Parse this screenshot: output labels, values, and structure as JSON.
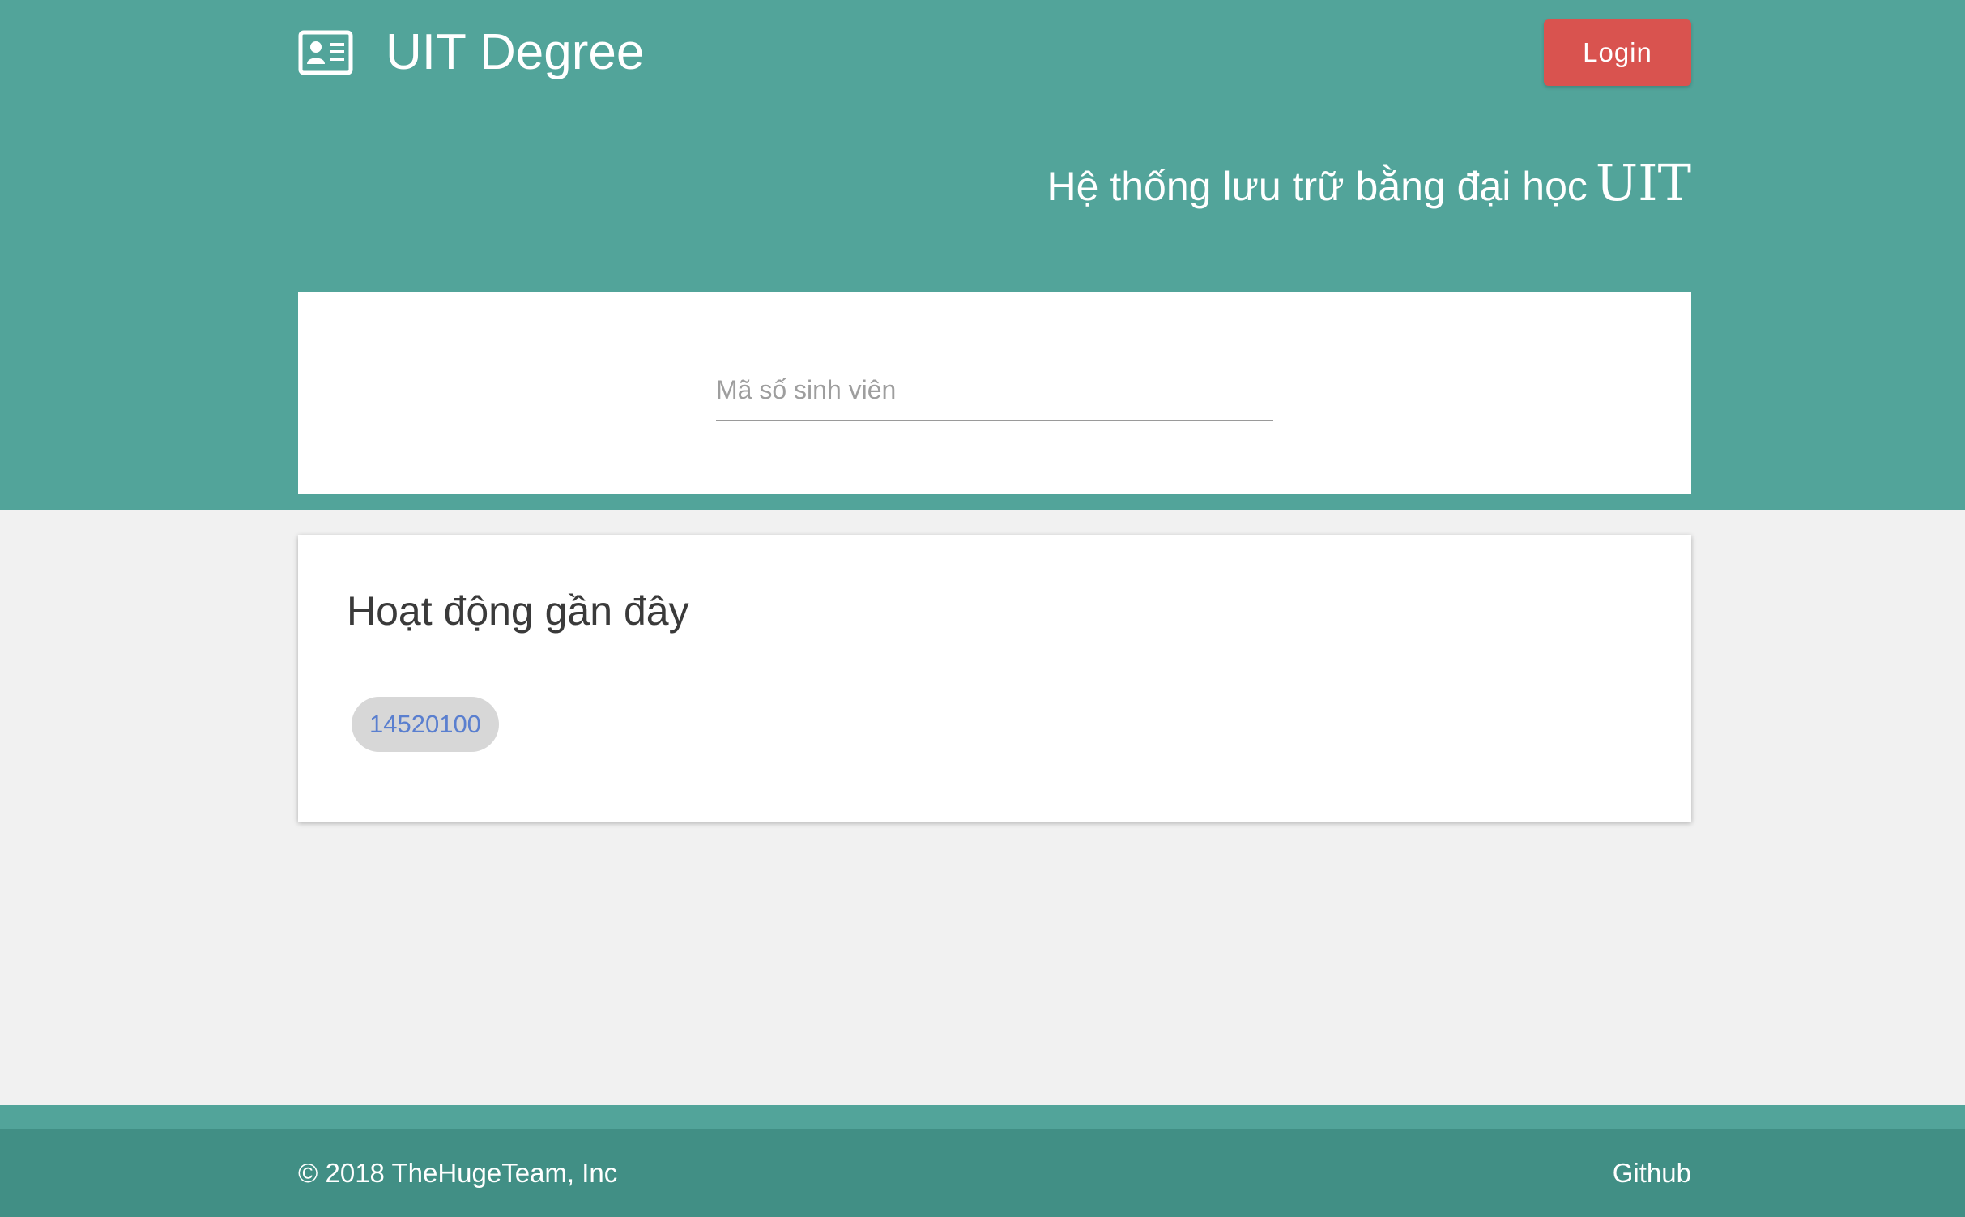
{
  "header": {
    "brand_title": "UIT Degree",
    "brand_icon": "id-card-icon",
    "login_label": "Login",
    "tagline_text": "Hệ thống lưu trữ bằng đại học",
    "tagline_brand": "UIT"
  },
  "search": {
    "placeholder": "Mã số sinh viên",
    "value": ""
  },
  "activity": {
    "title": "Hoạt động gần đây",
    "items": [
      {
        "label": "14520100"
      }
    ]
  },
  "footer": {
    "copyright": "© 2018 TheHugeTeam, Inc",
    "github_label": "Github"
  },
  "colors": {
    "primary_teal": "#52a49a",
    "footer_teal": "#418f85",
    "login_red": "#d9534f",
    "chip_text_blue": "#5a7fcf"
  }
}
